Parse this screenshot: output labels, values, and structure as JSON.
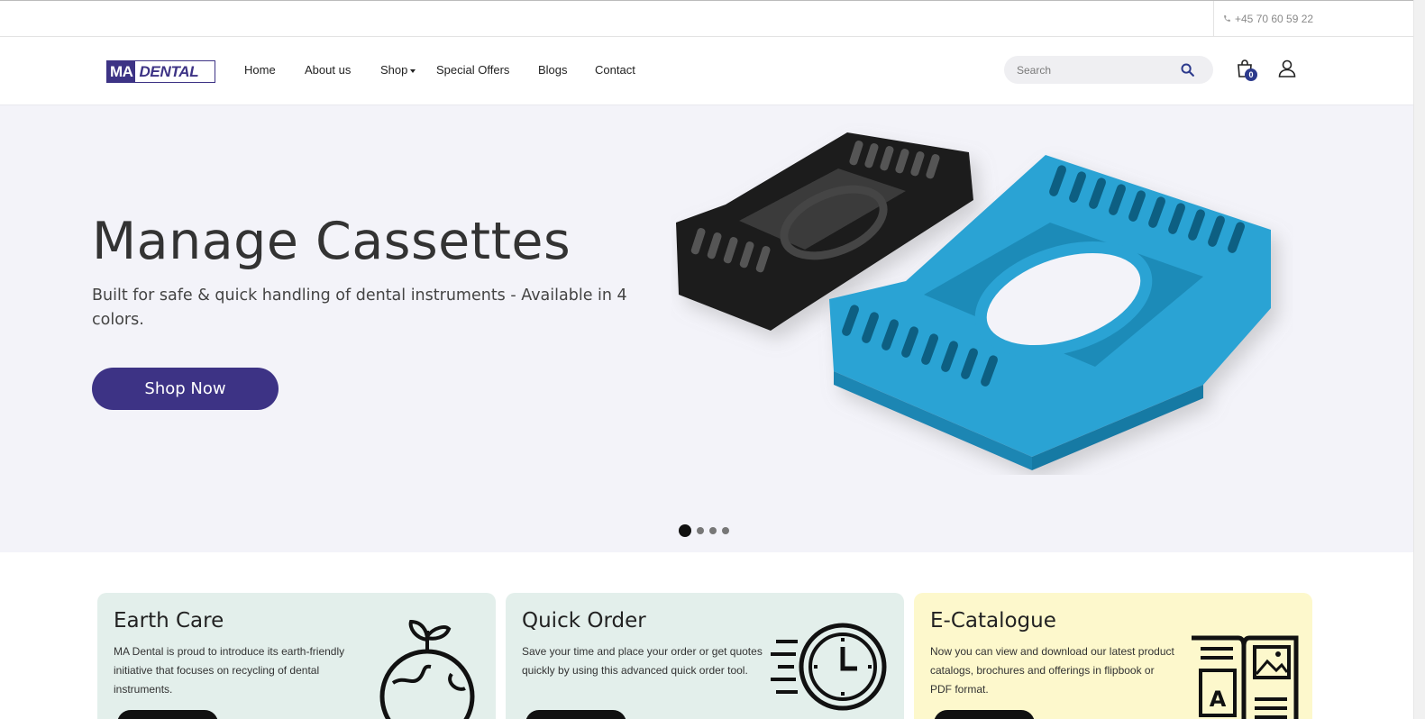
{
  "topbar": {
    "phone": "+45 70 60 59 22"
  },
  "header": {
    "logo": {
      "ma": "MA",
      "dental": "DENTAL"
    },
    "nav": [
      {
        "label": "Home"
      },
      {
        "label": "About us"
      },
      {
        "label": "Shop"
      },
      {
        "label": "Special Offers"
      },
      {
        "label": "Blogs"
      },
      {
        "label": "Contact"
      }
    ],
    "search": {
      "placeholder": "Search"
    },
    "cart_count": "0"
  },
  "hero": {
    "title": "Manage Cassettes",
    "subtitle": "Built for safe & quick handling of dental instruments - Available in 4 colors.",
    "button": "Shop Now",
    "slides_total": 4,
    "active_slide": 1
  },
  "cards": [
    {
      "title": "Earth Care",
      "text": "MA Dental is proud to introduce its earth-friendly initiative that focuses on recycling of dental instruments.",
      "bg": "#e3efeb",
      "icon": "globe-sprout-icon"
    },
    {
      "title": "Quick Order",
      "text": "Save your time and place your order or get quotes quickly by using this advanced quick order tool.",
      "bg": "#e3efeb",
      "icon": "fast-clock-icon"
    },
    {
      "title": "E-Catalogue",
      "text": "Now you can view and download our latest product catalogs, brochures and offerings in flipbook or PDF format.",
      "bg": "#fdf8cc",
      "icon": "open-catalogue-icon"
    }
  ],
  "colors": {
    "brand": "#3d3385",
    "hero_bg": "#f3f3f9",
    "cassette_blue": "#2aa3d4",
    "cassette_black": "#1a1a1a"
  }
}
